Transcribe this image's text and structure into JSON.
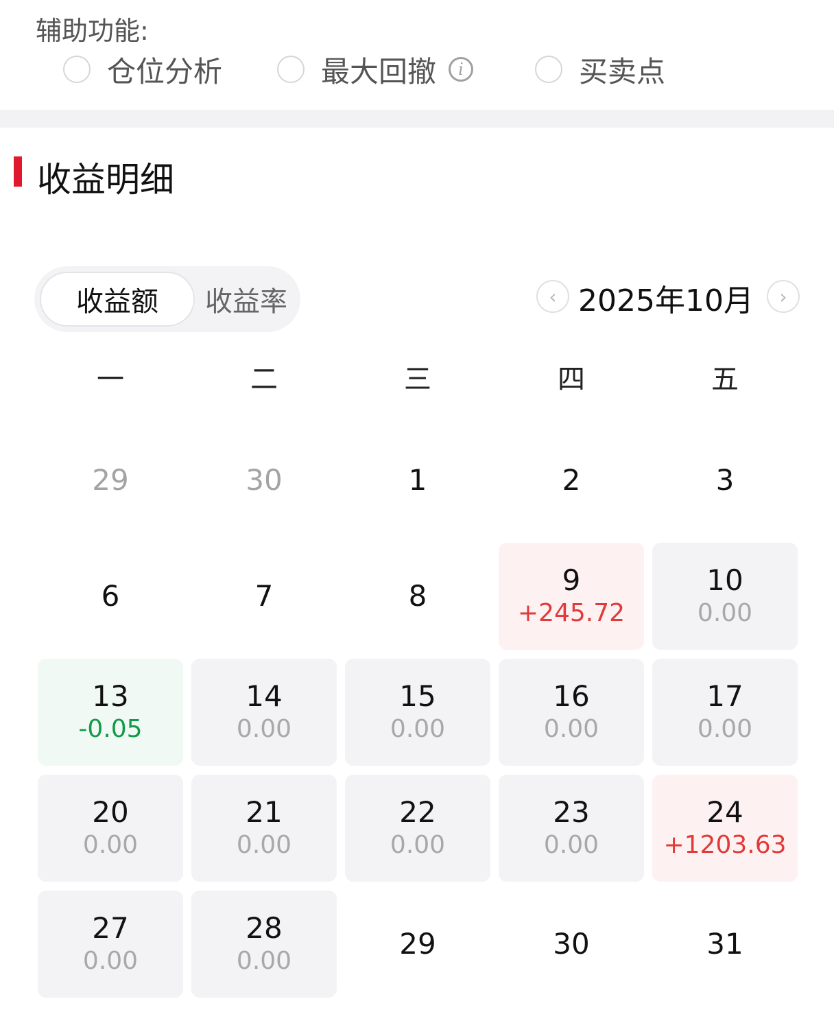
{
  "aux": {
    "label": "辅助功能:",
    "options": [
      {
        "label": "仓位分析"
      },
      {
        "label": "最大回撤",
        "info": "i"
      },
      {
        "label": "买卖点"
      }
    ]
  },
  "section": {
    "title": "收益明细"
  },
  "toggle": {
    "active": "收益额",
    "inactive": "收益率"
  },
  "month": {
    "label": "2025年10月",
    "prev": "‹",
    "next": "›"
  },
  "weekdays": [
    "一",
    "二",
    "三",
    "四",
    "五"
  ],
  "colors": {
    "accent": "#e0192f",
    "positive": "#e03a3a",
    "negative": "#129a4a"
  },
  "weeks": [
    [
      {
        "day": "29",
        "muted": true
      },
      {
        "day": "30",
        "muted": true
      },
      {
        "day": "1"
      },
      {
        "day": "2"
      },
      {
        "day": "3"
      }
    ],
    [
      {
        "day": "6"
      },
      {
        "day": "7"
      },
      {
        "day": "8"
      },
      {
        "day": "9",
        "value": "+245.72",
        "kind": "pos"
      },
      {
        "day": "10",
        "value": "0.00",
        "kind": "zero"
      }
    ],
    [
      {
        "day": "13",
        "value": "-0.05",
        "kind": "neg"
      },
      {
        "day": "14",
        "value": "0.00",
        "kind": "zero"
      },
      {
        "day": "15",
        "value": "0.00",
        "kind": "zero"
      },
      {
        "day": "16",
        "value": "0.00",
        "kind": "zero"
      },
      {
        "day": "17",
        "value": "0.00",
        "kind": "zero"
      }
    ],
    [
      {
        "day": "20",
        "value": "0.00",
        "kind": "zero"
      },
      {
        "day": "21",
        "value": "0.00",
        "kind": "zero"
      },
      {
        "day": "22",
        "value": "0.00",
        "kind": "zero"
      },
      {
        "day": "23",
        "value": "0.00",
        "kind": "zero"
      },
      {
        "day": "24",
        "value": "+1203.63",
        "kind": "pos"
      }
    ],
    [
      {
        "day": "27",
        "value": "0.00",
        "kind": "zero"
      },
      {
        "day": "28",
        "value": "0.00",
        "kind": "zero"
      },
      {
        "day": "29"
      },
      {
        "day": "30"
      },
      {
        "day": "31"
      }
    ]
  ]
}
